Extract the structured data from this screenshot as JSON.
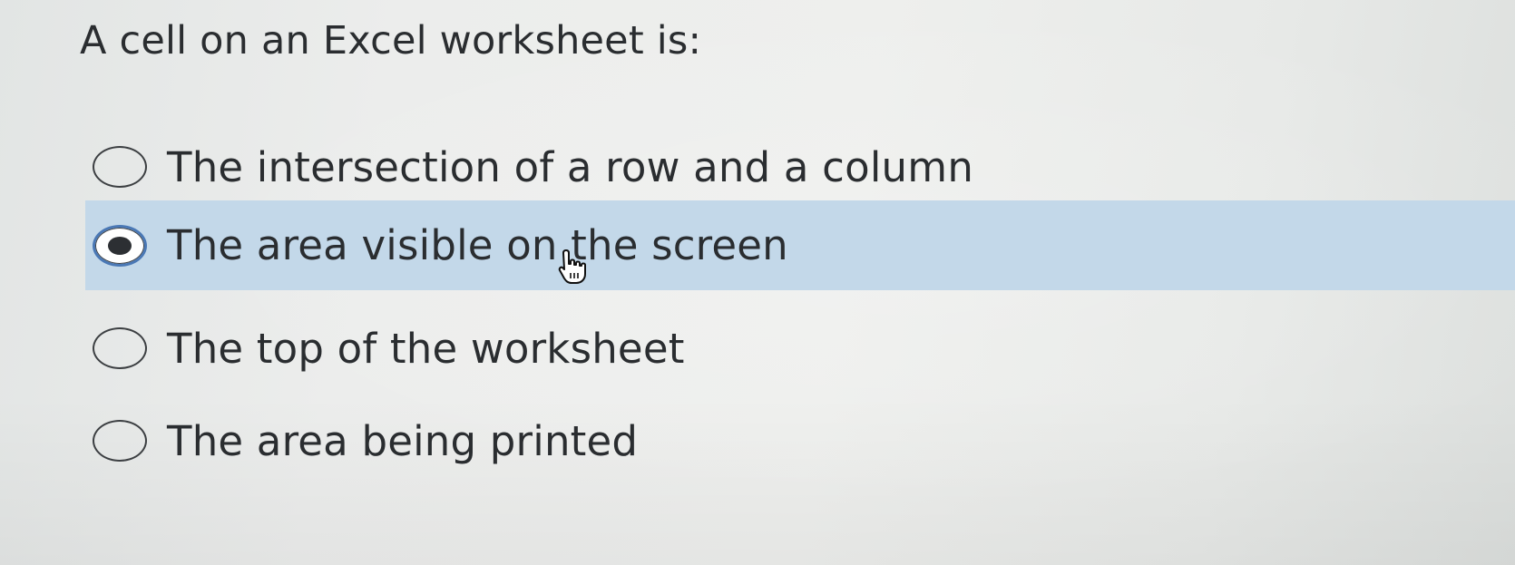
{
  "question": {
    "text": "A cell on an Excel worksheet is:"
  },
  "options": [
    {
      "label": "The intersection of a row and a column",
      "selected": false
    },
    {
      "label": "The area visible on the screen",
      "selected": true
    },
    {
      "label": "The top of the worksheet",
      "selected": false
    },
    {
      "label": "The area being printed",
      "selected": false
    }
  ],
  "colors": {
    "selected_row": "#c3d8e9",
    "radio_selected_ring": "#4a78b5",
    "text": "#2a2d30"
  },
  "icons": {
    "cursor": "hand-pointer-icon"
  }
}
